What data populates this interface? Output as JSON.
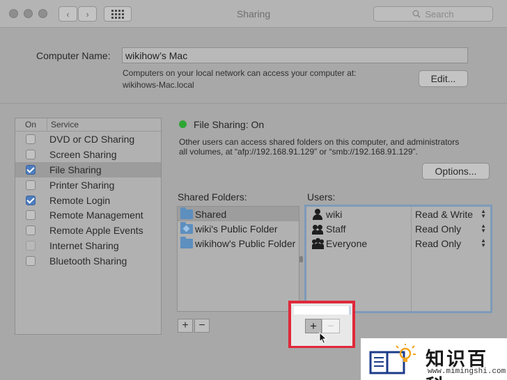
{
  "window": {
    "title": "Sharing",
    "search_placeholder": "Search",
    "back_glyph": "‹",
    "forward_glyph": "›"
  },
  "computer": {
    "label": "Computer Name:",
    "name": "wikihow’s Mac",
    "description_line1": "Computers on your local network can access your computer at:",
    "description_line2": "wikihows-Mac.local",
    "edit_label": "Edit..."
  },
  "services": {
    "header_on": "On",
    "header_service": "Service",
    "items": [
      {
        "label": "DVD or CD Sharing",
        "checked": false,
        "selected": false,
        "enabled": true
      },
      {
        "label": "Screen Sharing",
        "checked": false,
        "selected": false,
        "enabled": true
      },
      {
        "label": "File Sharing",
        "checked": true,
        "selected": true,
        "enabled": true
      },
      {
        "label": "Printer Sharing",
        "checked": false,
        "selected": false,
        "enabled": true
      },
      {
        "label": "Remote Login",
        "checked": true,
        "selected": false,
        "enabled": true
      },
      {
        "label": "Remote Management",
        "checked": false,
        "selected": false,
        "enabled": true
      },
      {
        "label": "Remote Apple Events",
        "checked": false,
        "selected": false,
        "enabled": true
      },
      {
        "label": "Internet Sharing",
        "checked": false,
        "selected": false,
        "enabled": false
      },
      {
        "label": "Bluetooth Sharing",
        "checked": false,
        "selected": false,
        "enabled": true
      }
    ]
  },
  "file_sharing": {
    "status": "File Sharing: On",
    "status_color": "#2fa634",
    "description_line1": "Other users can access shared folders on this computer, and administrators",
    "description_line2": "all volumes, at “afp://192.168.91.129” or “smb://192.168.91.129”.",
    "options_label": "Options..."
  },
  "shared_folders": {
    "label": "Shared Folders:",
    "items": [
      {
        "label": "Shared",
        "icon": "folder-icon",
        "selected": true
      },
      {
        "label": "wiki's Public Folder",
        "icon": "public-folder-icon",
        "selected": false
      },
      {
        "label": "wikihow's Public Folder",
        "icon": "folder-icon",
        "selected": false
      }
    ],
    "add_label": "+",
    "remove_label": "−"
  },
  "users": {
    "label": "Users:",
    "items": [
      {
        "name": "wiki",
        "icon": "user-icon",
        "permission": "Read & Write"
      },
      {
        "name": "Staff",
        "icon": "group-icon",
        "permission": "Read Only"
      },
      {
        "name": "Everyone",
        "icon": "everyone-icon",
        "permission": "Read Only"
      }
    ],
    "add_label": "+",
    "remove_label": "−",
    "stepper_up": "▲",
    "stepper_down": "▼"
  },
  "highlight_color": "#e0283a",
  "logo": {
    "title": "知识百科",
    "url": "www.mimingshi.com"
  }
}
